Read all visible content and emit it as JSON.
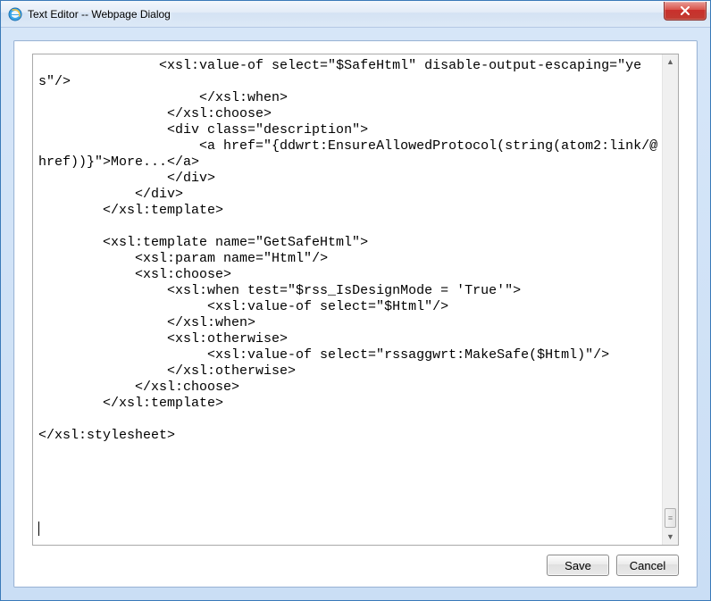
{
  "titlebar": {
    "title": "Text Editor -- Webpage Dialog"
  },
  "editor": {
    "text": "               <xsl:value-of select=\"$SafeHtml\" disable-output-escaping=\"yes\"/>\n                    </xsl:when>\n                </xsl:choose>\n                <div class=\"description\">\n                    <a href=\"{ddwrt:EnsureAllowedProtocol(string(atom2:link/@href))}\">More...</a>\n                </div>\n            </div>\n        </xsl:template>\n\n        <xsl:template name=\"GetSafeHtml\">\n            <xsl:param name=\"Html\"/>\n            <xsl:choose>\n                <xsl:when test=\"$rss_IsDesignMode = 'True'\">\n                     <xsl:value-of select=\"$Html\"/>\n                </xsl:when>\n                <xsl:otherwise>\n                     <xsl:value-of select=\"rssaggwrt:MakeSafe($Html)\"/>\n                </xsl:otherwise>\n            </xsl:choose>\n        </xsl:template>\n\n</xsl:stylesheet>\n"
  },
  "buttons": {
    "save": "Save",
    "cancel": "Cancel"
  }
}
